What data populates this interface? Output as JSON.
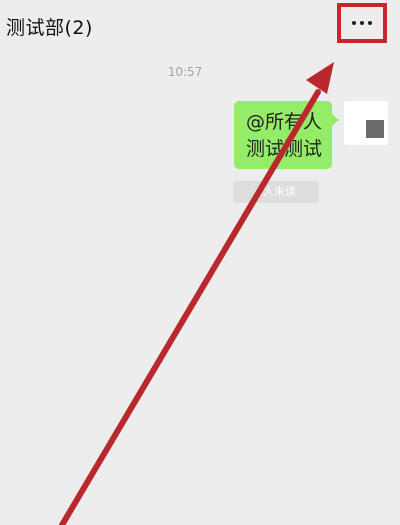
{
  "header": {
    "title": "测试部(2)",
    "more_icon": "more-horizontal-icon"
  },
  "messages": [
    {
      "timestamp": "10:57",
      "lines": [
        "@所有人",
        "测试测试"
      ],
      "status": "1人未读"
    }
  ],
  "colors": {
    "background": "#ededed",
    "bubble": "#95ec69",
    "highlight": "#c9252b"
  }
}
